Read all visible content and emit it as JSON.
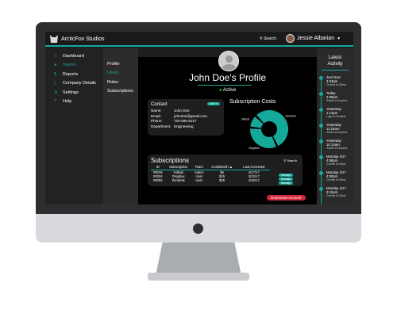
{
  "app": {
    "brand": "ArcticFox Studios",
    "search_label": "Search",
    "user_name": "Jessie Albarian"
  },
  "sidebar": {
    "items": [
      {
        "label": "Dashboard",
        "icon": "dashboard-icon"
      },
      {
        "label": "Teams",
        "icon": "teams-icon",
        "active": true
      },
      {
        "label": "Reports",
        "icon": "reports-icon"
      },
      {
        "label": "Company Details",
        "icon": "company-icon"
      },
      {
        "label": "Settings",
        "icon": "settings-icon"
      },
      {
        "label": "Help",
        "icon": "help-icon"
      }
    ]
  },
  "subnav": {
    "items": [
      "Profile",
      "Users",
      "Roles",
      "Subscriptions"
    ],
    "active": "Users"
  },
  "profile": {
    "title": "John Doe's Profile",
    "status": "Active"
  },
  "contact": {
    "title": "Contact",
    "edit_label": "Edit",
    "fields": [
      {
        "k": "Name:",
        "v": "John Doe"
      },
      {
        "k": "Email:",
        "v": "johndoe@gmail.com"
      },
      {
        "k": "Phone:",
        "v": "720-555-5217"
      },
      {
        "k": "Department:",
        "v": "Engineering"
      }
    ]
  },
  "chart_data": {
    "type": "pie",
    "title": "Subscription Costs",
    "categories": [
      "Zendesk",
      "Dropbox",
      "Github"
    ],
    "values": [
      25,
      15,
      5
    ],
    "color": "#15a99a"
  },
  "subscriptions": {
    "title": "Subscriptions",
    "search_label": "Search",
    "columns": [
      "ID",
      "Subscription",
      "Team",
      "Cost/Month ▲",
      "Last Accessed"
    ],
    "rows": [
      [
        "#0018",
        "Github",
        "Admin",
        "$5",
        "4/17/17"
      ],
      [
        "#0024",
        "Dropbox",
        "User",
        "$15",
        "3/22/17"
      ],
      [
        "#0056",
        "Zendesk",
        "User",
        "$25",
        "4/20/17"
      ]
    ],
    "manage_label": "Manage"
  },
  "deactivate_label": "Deactivate Account",
  "activity": {
    "title1": "Latest",
    "title2": "Activity",
    "items": [
      {
        "day": "Just Now",
        "time": "4:34pm",
        "desc": "Commit to Github"
      },
      {
        "day": "Today",
        "time": "3:38pm",
        "desc": "Submit to Dropbox"
      },
      {
        "day": "Yesterday",
        "time": "1:14pm",
        "desc": "Login to Zendesk"
      },
      {
        "day": "Yesterday",
        "time": "11:10am",
        "desc": "Submit to Dropbox"
      },
      {
        "day": "Yesterday",
        "time": "10:10am",
        "desc": "Submit to Dropbox"
      },
      {
        "day": "Monday 4/17",
        "time": "4:58pm",
        "desc": "Commit to Github"
      },
      {
        "day": "Monday 4/17",
        "time": "4:00pm",
        "desc": "Commit to Github"
      },
      {
        "day": "Monday 4/17",
        "time": "3:10pm",
        "desc": "Commit to Github"
      }
    ]
  },
  "colors": {
    "accent": "#15a99a",
    "danger": "#d3263a"
  }
}
